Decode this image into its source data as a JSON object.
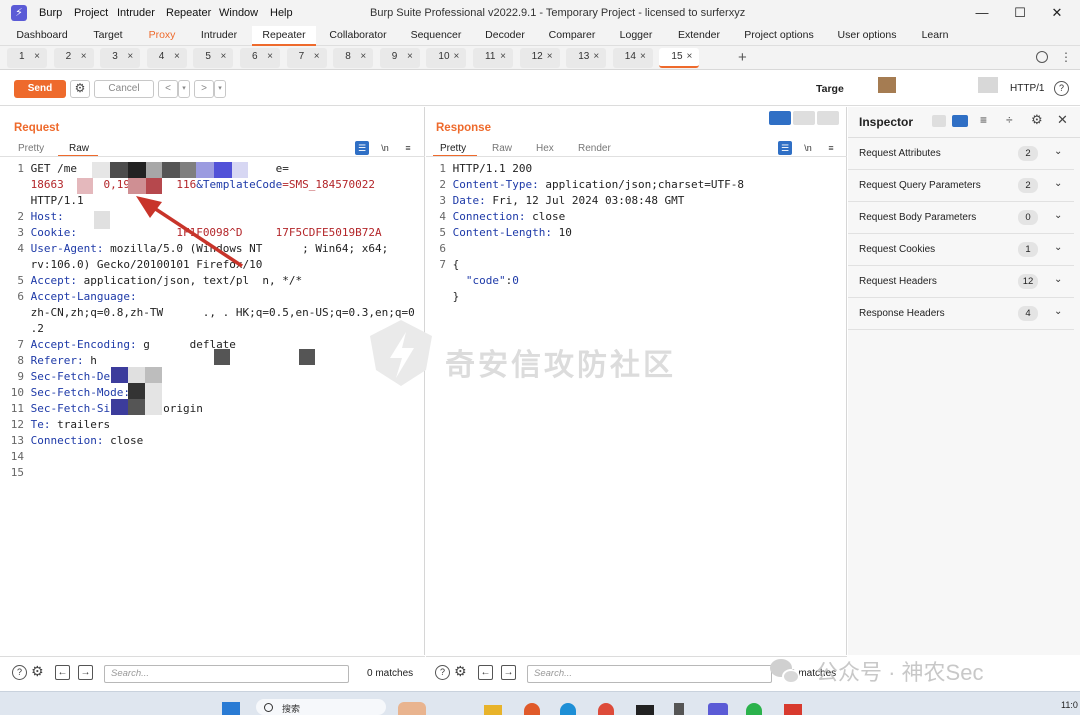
{
  "window": {
    "title": "Burp Suite Professional v2022.9.1 - Temporary Project - licensed to surferxyz",
    "menus": [
      "Burp",
      "Project",
      "Intruder",
      "Repeater",
      "Window",
      "Help"
    ],
    "controls": {
      "minimize": "—",
      "maximize": "☐",
      "close": "✕"
    }
  },
  "main_tabs": [
    "Dashboard",
    "Target",
    "Proxy",
    "Intruder",
    "Repeater",
    "Collaborator",
    "Sequencer",
    "Decoder",
    "Comparer",
    "Logger",
    "Extender",
    "Project options",
    "User options",
    "Learn"
  ],
  "active_main_tab": "Repeater",
  "sub_tabs": [
    "1",
    "2",
    "3",
    "4",
    "5",
    "6",
    "7",
    "8",
    "9",
    "10",
    "11",
    "12",
    "13",
    "14",
    "15"
  ],
  "active_sub_tab": "15",
  "sub_tab_close": "×",
  "add_tab": "+",
  "toolbar": {
    "send": "Send",
    "cancel": "Cancel",
    "back": "<",
    "forward": ">",
    "target_label": "Targe",
    "http_version": "HTTP/1"
  },
  "request": {
    "title": "Request",
    "tabs": [
      "Pretty",
      "Raw"
    ],
    "active_tab": "Raw",
    "lines": [
      {
        "n": "1",
        "parts": [
          {
            "t": "GET /me",
            "c": "plain"
          },
          {
            "t": "                              ",
            "c": "plain"
          },
          {
            "t": "e=",
            "c": "plain"
          }
        ]
      },
      {
        "n": "",
        "parts": [
          {
            "t": "18663      0,195      116",
            "c": "str"
          },
          {
            "t": "&TemplateCode",
            "c": "kw"
          },
          {
            "t": "=SMS_184570022",
            "c": "str"
          }
        ]
      },
      {
        "n": "",
        "parts": [
          {
            "t": "HTTP/1.1",
            "c": "plain"
          }
        ]
      },
      {
        "n": "2",
        "parts": [
          {
            "t": "Host:",
            "c": "kw"
          },
          {
            "t": "    ",
            "c": "plain"
          }
        ]
      },
      {
        "n": "3",
        "parts": [
          {
            "t": "Cookie:",
            "c": "kw"
          },
          {
            "t": "               1F1F0098^D     17F5CDFE5019B72A",
            "c": "str"
          }
        ]
      },
      {
        "n": "4",
        "parts": [
          {
            "t": "User-Agent:",
            "c": "kw"
          },
          {
            "t": " mozilla/5.0 (Windows NT      ; Win64; x64;",
            "c": "plain"
          }
        ]
      },
      {
        "n": "",
        "parts": [
          {
            "t": "rv:106.0) Gecko/20100101 Firefox/10",
            "c": "plain"
          }
        ]
      },
      {
        "n": "5",
        "parts": [
          {
            "t": "Accept:",
            "c": "kw"
          },
          {
            "t": " application/json, text/pl  n, */*",
            "c": "plain"
          }
        ]
      },
      {
        "n": "6",
        "parts": [
          {
            "t": "Accept-Language:",
            "c": "kw"
          }
        ]
      },
      {
        "n": "",
        "parts": [
          {
            "t": "zh-CN,zh;q=0.8,zh-TW      ., . HK;q=0.5,en-US;q=0.3,en;q=0",
            "c": "plain"
          }
        ]
      },
      {
        "n": "",
        "parts": [
          {
            "t": ".2",
            "c": "plain"
          }
        ]
      },
      {
        "n": "7",
        "parts": [
          {
            "t": "Accept-Encoding:",
            "c": "kw"
          },
          {
            "t": " g      deflate",
            "c": "plain"
          }
        ]
      },
      {
        "n": "8",
        "parts": [
          {
            "t": "Referer:",
            "c": "kw"
          },
          {
            "t": " h",
            "c": "plain"
          }
        ]
      },
      {
        "n": "9",
        "parts": [
          {
            "t": "Sec-Fetch-Des",
            "c": "kw"
          }
        ]
      },
      {
        "n": "10",
        "parts": [
          {
            "t": "Sec-Fetch-Mode:",
            "c": "kw"
          }
        ]
      },
      {
        "n": "11",
        "parts": [
          {
            "t": "Sec-Fetch-Si",
            "c": "kw"
          },
          {
            "t": "       -origin",
            "c": "plain"
          }
        ]
      },
      {
        "n": "12",
        "parts": [
          {
            "t": "Te:",
            "c": "kw"
          },
          {
            "t": " trailers",
            "c": "plain"
          }
        ]
      },
      {
        "n": "13",
        "parts": [
          {
            "t": "Connection:",
            "c": "kw"
          },
          {
            "t": " close",
            "c": "plain"
          }
        ]
      },
      {
        "n": "14",
        "parts": []
      },
      {
        "n": "15",
        "parts": []
      }
    ],
    "search_placeholder": "Search...",
    "matches": "0 matches"
  },
  "response": {
    "title": "Response",
    "tabs": [
      "Pretty",
      "Raw",
      "Hex",
      "Render"
    ],
    "active_tab": "Pretty",
    "lines": [
      {
        "n": "1",
        "parts": [
          {
            "t": "HTTP/1.1 200",
            "c": "plain"
          }
        ]
      },
      {
        "n": "2",
        "parts": [
          {
            "t": "Content-Type:",
            "c": "kw"
          },
          {
            "t": " application/json;charset=UTF-8",
            "c": "plain"
          }
        ]
      },
      {
        "n": "3",
        "parts": [
          {
            "t": "Date:",
            "c": "kw"
          },
          {
            "t": " Fri, 12 Jul 2024 03:08:48 GMT",
            "c": "plain"
          }
        ]
      },
      {
        "n": "4",
        "parts": [
          {
            "t": "Connection:",
            "c": "kw"
          },
          {
            "t": " close",
            "c": "plain"
          }
        ]
      },
      {
        "n": "5",
        "parts": [
          {
            "t": "Content-Length:",
            "c": "kw"
          },
          {
            "t": " 10",
            "c": "plain"
          }
        ]
      },
      {
        "n": "6",
        "parts": []
      },
      {
        "n": "7",
        "parts": [
          {
            "t": "{",
            "c": "plain"
          }
        ]
      },
      {
        "n": "",
        "parts": [
          {
            "t": "  ",
            "c": "plain"
          },
          {
            "t": "\"code\"",
            "c": "kw"
          },
          {
            "t": ":",
            "c": "plain"
          },
          {
            "t": "0",
            "c": "kw"
          }
        ]
      },
      {
        "n": "",
        "parts": [
          {
            "t": "}",
            "c": "plain"
          }
        ]
      }
    ],
    "search_placeholder": "Search...",
    "matches": "0 matches"
  },
  "inspector": {
    "title": "Inspector",
    "rows": [
      {
        "label": "Request Attributes",
        "count": "2"
      },
      {
        "label": "Request Query Parameters",
        "count": "2"
      },
      {
        "label": "Request Body Parameters",
        "count": "0"
      },
      {
        "label": "Request Cookies",
        "count": "1"
      },
      {
        "label": "Request Headers",
        "count": "12"
      },
      {
        "label": "Response Headers",
        "count": "4"
      }
    ]
  },
  "watermarks": {
    "center": "奇安信攻防社区",
    "corner": "公众号 · 神农Sec"
  },
  "taskbar": {
    "search": "搜索",
    "time": "11:0"
  },
  "colors": {
    "accent": "#ee6a2c",
    "keyword": "#1e3aa8",
    "value": "#b3262a",
    "arrow": "#c8342a"
  }
}
